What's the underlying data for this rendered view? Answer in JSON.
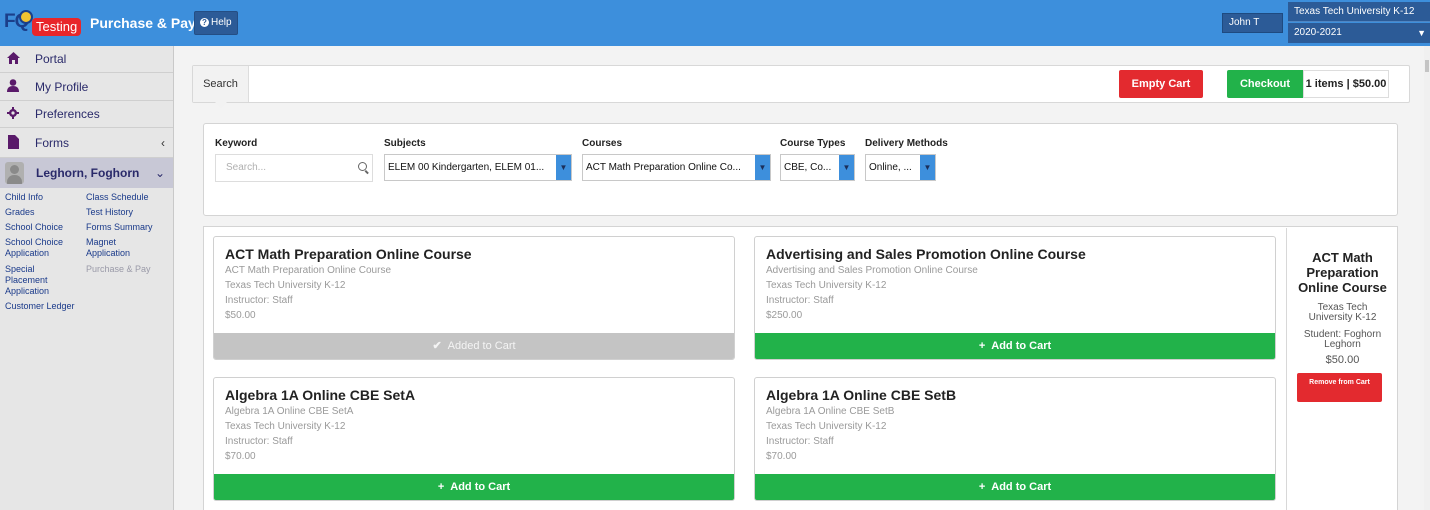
{
  "header": {
    "logo_text": "FQ",
    "env_badge": "Testing",
    "app_title": "Purchase & Pay",
    "help_label": "Help",
    "user_name": "John T",
    "district": "Texas Tech University K-12",
    "school_year": "2020-2021",
    "colors": {
      "bar": "#3d8fdc",
      "badge": "#e8262a"
    }
  },
  "sidebar": {
    "items": [
      {
        "label": "Portal",
        "icon": "home-icon"
      },
      {
        "label": "My Profile",
        "icon": "user-icon"
      },
      {
        "label": "Preferences",
        "icon": "gear-icon"
      },
      {
        "label": "Forms",
        "icon": "file-icon"
      }
    ],
    "student_name": "Leghorn, Foghorn",
    "links_col1": [
      "Child Info",
      "Grades",
      "School Choice",
      "School Choice Application",
      "Special Placement Application",
      "Customer Ledger"
    ],
    "links_col2": [
      "Class Schedule",
      "Test History",
      "Forms Summary",
      "Magnet Application",
      "Purchase & Pay"
    ]
  },
  "toolbar": {
    "search_tab": "Search",
    "empty_cart": "Empty Cart",
    "checkout": "Checkout",
    "cart_summary": "1 items | $50.00"
  },
  "filters": {
    "keyword_label": "Keyword",
    "keyword_placeholder": "Search...",
    "subjects_label": "Subjects",
    "subjects_value": "ELEM 00 Kindergarten, ELEM 01...",
    "courses_label": "Courses",
    "courses_value": "ACT Math Preparation Online Co...",
    "course_types_label": "Course Types",
    "course_types_value": "CBE, Co...",
    "delivery_label": "Delivery Methods",
    "delivery_value": "Online, ..."
  },
  "courses": [
    {
      "title": "ACT Math Preparation Online Course",
      "subtitle": "ACT Math Preparation Online Course",
      "school": "Texas Tech University K-12",
      "instructor": "Instructor: Staff",
      "price": "$50.00",
      "action": "Added to Cart",
      "in_cart": true
    },
    {
      "title": "Advertising and Sales Promotion Online Course",
      "subtitle": "Advertising and Sales Promotion Online Course",
      "school": "Texas Tech University K-12",
      "instructor": "Instructor: Staff",
      "price": "$250.00",
      "action": "Add to Cart",
      "in_cart": false
    },
    {
      "title": "Algebra 1A Online CBE SetA",
      "subtitle": "Algebra 1A Online CBE SetA",
      "school": "Texas Tech University K-12",
      "instructor": "Instructor: Staff",
      "price": "$70.00",
      "action": "Add to Cart",
      "in_cart": false
    },
    {
      "title": "Algebra 1A Online CBE SetB",
      "subtitle": "Algebra 1A Online CBE SetB",
      "school": "Texas Tech University K-12",
      "instructor": "Instructor: Staff",
      "price": "$70.00",
      "action": "Add to Cart",
      "in_cart": false
    }
  ],
  "cart_panel": {
    "title": "ACT Math Preparation Online Course",
    "school": "Texas Tech University K-12",
    "student": "Student: Foghorn Leghorn",
    "price": "$50.00",
    "remove_label": "Remove from Cart"
  }
}
